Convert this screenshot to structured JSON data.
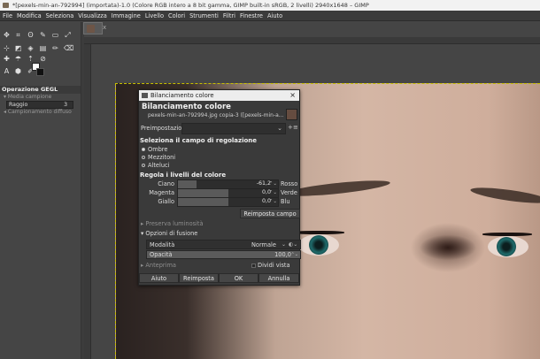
{
  "window": {
    "title": "*[pexels-min-an-792994] (importata)-1.0 (Colore RGB intero a 8 bit gamma, GIMP built-in sRGB, 2 livelli) 2940x1648 – GIMP"
  },
  "menu": [
    "File",
    "Modifica",
    "Seleziona",
    "Visualizza",
    "Immagine",
    "Livello",
    "Colori",
    "Strumenti",
    "Filtri",
    "Finestre",
    "Aiuto"
  ],
  "dock": {
    "title": "Operazione GEGL",
    "sample_average": "Media campione",
    "radius_label": "Raggio",
    "radius_value": "3",
    "sample_merged": "Campionamento diffuso"
  },
  "image_tab": {
    "close": "x"
  },
  "dialog": {
    "window_title": "Bilanciamento colore",
    "close": "×",
    "heading": "Bilanciamento colore",
    "subtitle": "pexels-min-an-792994.jpg copia-3 ([pexels-min-a...",
    "presets_label": "Preimpostazioni:",
    "preset_add": "+",
    "preset_menu": "≡",
    "range_section": "Seleziona il campo di regolazione",
    "ranges": [
      {
        "label": "Ombre",
        "selected": true
      },
      {
        "label": "Mezzitoni",
        "selected": false
      },
      {
        "label": "Alteluci",
        "selected": false
      }
    ],
    "levels_section": "Regola i livelli del colore",
    "sliders": [
      {
        "left": "Ciano",
        "value": "-61,2",
        "right": "Rosso",
        "fraction": 0.19
      },
      {
        "left": "Magenta",
        "value": "0,0",
        "right": "Verde",
        "fraction": 0.5
      },
      {
        "left": "Giallo",
        "value": "0,0",
        "right": "Blu",
        "fraction": 0.5
      }
    ],
    "reset_range": "Reimposta campo",
    "preserve_luminosity": "Preserva luminosità",
    "blending_options": "Opzioni di fusione",
    "mode_label": "Modalità",
    "mode_value": "Normale",
    "opacity_label": "Opacità",
    "opacity_value": "100,0",
    "preview": "Anteprima",
    "split_view": "Dividi vista",
    "buttons": {
      "help": "Aiuto",
      "reset": "Reimposta",
      "ok": "OK",
      "cancel": "Annulla"
    }
  }
}
